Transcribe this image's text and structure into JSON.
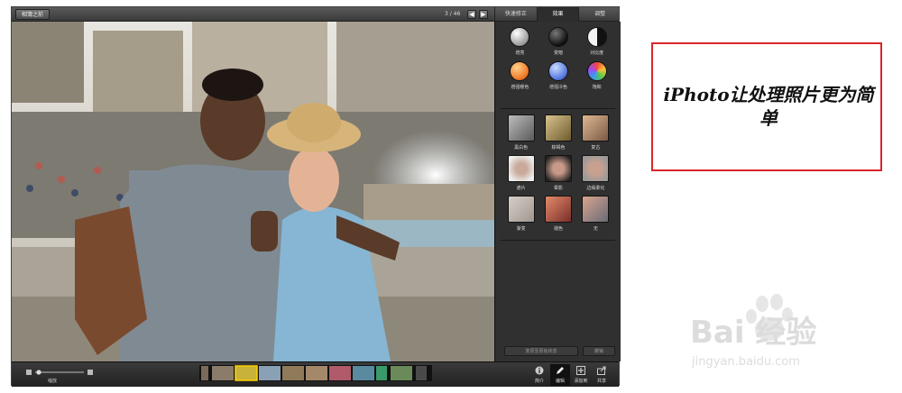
{
  "topbar": {
    "back_label": "相簿之前",
    "counter": "3 / 46",
    "prev_icon": "◀",
    "next_icon": "▶"
  },
  "tabs": [
    {
      "label": "快速修正"
    },
    {
      "label": "效果"
    },
    {
      "label": "调整"
    }
  ],
  "adjustments": [
    {
      "label": "增亮",
      "icon": "brighten-ball"
    },
    {
      "label": "变暗",
      "icon": "darken-ball"
    },
    {
      "label": "对比度",
      "icon": "contrast-ball"
    },
    {
      "label": "增强暖色",
      "icon": "warm-ball"
    },
    {
      "label": "增强冷色",
      "icon": "cool-ball"
    },
    {
      "label": "饱和",
      "icon": "saturate-ball"
    }
  ],
  "effects": [
    {
      "label": "黑白色"
    },
    {
      "label": "棕褐色"
    },
    {
      "label": "复古"
    },
    {
      "label": "遮片"
    },
    {
      "label": "晕影"
    },
    {
      "label": "边缘柔化"
    },
    {
      "label": "渐变"
    },
    {
      "label": "褪色"
    },
    {
      "label": "无"
    }
  ],
  "panel_buttons": {
    "revert": "复原至原始状态",
    "undo": "撤销"
  },
  "bottombar": {
    "zoom_label": "缩放",
    "tools": [
      {
        "label": "简介",
        "icon": "info-icon"
      },
      {
        "label": "编辑",
        "icon": "pencil-icon"
      },
      {
        "label": "添加到",
        "icon": "plus-icon"
      },
      {
        "label": "共享",
        "icon": "share-icon"
      }
    ]
  },
  "callout": {
    "text": "iPhoto让处理照片更为简单"
  },
  "watermark": {
    "brand": "Bai 经验",
    "url": "jingyan.baidu.com"
  },
  "colors": {
    "accent_red": "#d9262b",
    "panel_bg": "#303030",
    "chrome_dark": "#1f1f1f"
  }
}
